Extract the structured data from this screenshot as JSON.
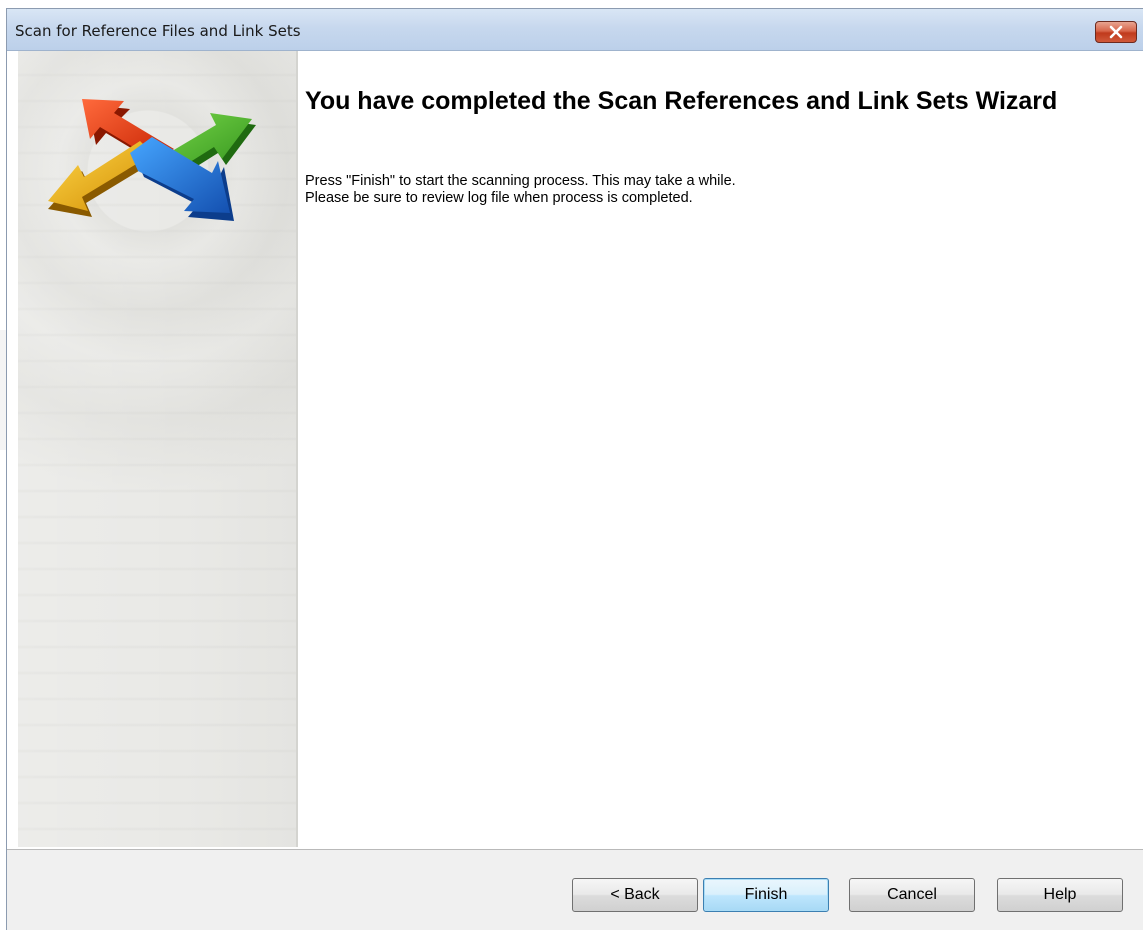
{
  "window": {
    "title": "Scan for Reference Files and Link Sets"
  },
  "icons": {
    "close": "close-icon",
    "logo": "four-arrows-logo-icon"
  },
  "main": {
    "heading": "You have completed the Scan References and Link Sets Wizard",
    "description_line1": "Press \"Finish\" to start the scanning process. This may take a while.",
    "description_line2": "Please be sure to review log file when process is completed."
  },
  "footer": {
    "back_label": "< Back",
    "finish_label": "Finish",
    "cancel_label": "Cancel",
    "help_label": "Help"
  },
  "colors": {
    "titlebar": "#c7d8ee",
    "close_button": "#c03a1c",
    "arrow_red": "#e23a12",
    "arrow_green": "#4cb52d",
    "arrow_yellow": "#f2b400",
    "arrow_blue": "#1f78d8",
    "default_button_border": "#3c7fb1"
  }
}
